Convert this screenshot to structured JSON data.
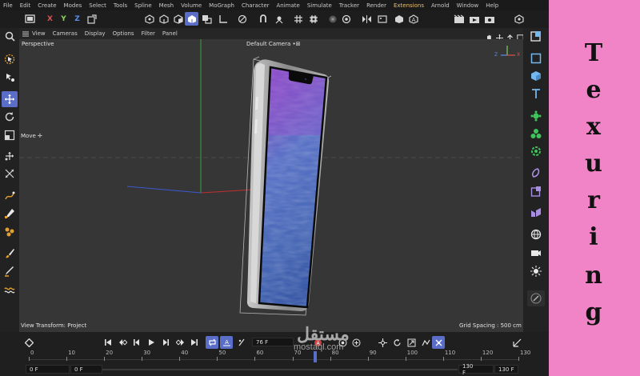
{
  "menubar": {
    "items": [
      {
        "label": "File",
        "hl": false
      },
      {
        "label": "Edit",
        "hl": false
      },
      {
        "label": "Create",
        "hl": false
      },
      {
        "label": "Modes",
        "hl": false
      },
      {
        "label": "Select",
        "hl": false
      },
      {
        "label": "Tools",
        "hl": false
      },
      {
        "label": "Spline",
        "hl": false
      },
      {
        "label": "Mesh",
        "hl": false
      },
      {
        "label": "Volume",
        "hl": false
      },
      {
        "label": "MoGraph",
        "hl": false
      },
      {
        "label": "Character",
        "hl": false
      },
      {
        "label": "Animate",
        "hl": false
      },
      {
        "label": "Simulate",
        "hl": false
      },
      {
        "label": "Tracker",
        "hl": false
      },
      {
        "label": "Render",
        "hl": false
      },
      {
        "label": "Extensions",
        "hl": true
      },
      {
        "label": "Arnold",
        "hl": false
      },
      {
        "label": "Window",
        "hl": false
      },
      {
        "label": "Help",
        "hl": false
      }
    ]
  },
  "toolbar": {
    "axis_x": "X",
    "axis_y": "Y",
    "axis_z": "Z"
  },
  "viewport_menu": {
    "items": [
      "View",
      "Cameras",
      "Display",
      "Options",
      "Filter",
      "Panel"
    ]
  },
  "viewport": {
    "projection_label": "Perspective",
    "camera_label": "Default Camera",
    "camera_suffix": "•⊞",
    "tool_label": "Move ✛",
    "view_transform": "View Transform: Project",
    "grid_spacing": "Grid Spacing : 500 cm",
    "axis_z": "Z",
    "axis_x": "X",
    "axis_y": "Y"
  },
  "timeline": {
    "current_frame": "76 F",
    "ticks": [
      "0",
      "10",
      "20",
      "30",
      "40",
      "50",
      "60",
      "70",
      "80",
      "90",
      "100",
      "110",
      "120",
      "130"
    ],
    "start_field": "0 F",
    "preview_start": "0 F",
    "preview_end": "130 F",
    "end_field": "130 F",
    "current_frame_value": 76,
    "max_frame": 130
  },
  "side_panel": {
    "letters": [
      "T",
      "e",
      "x",
      "u",
      "r",
      "i",
      "n",
      "g"
    ]
  },
  "watermark": {
    "arabic": "مستقل",
    "latin": "mostaql.com"
  },
  "colors": {
    "accent": "#5a6ec8",
    "side_panel": "#f084c6",
    "viewport_bg": "#363636",
    "axis_x": "#e05050",
    "axis_y": "#8fd060",
    "axis_z": "#5a8ee8"
  },
  "icons": {
    "left_toolbar": [
      "search-icon",
      "live-selection-icon",
      "sub-tool-icon",
      "move-icon",
      "rotate-icon",
      "scale-icon",
      "transform-icon",
      "extrude-icon",
      "spline-pen-icon",
      "sketch-icon",
      "paint-icon",
      "brush-icon",
      "knife-icon",
      "weight-icon"
    ],
    "right_toolbar": [
      "attribute-icon",
      "cube-outline-icon",
      "cube-icon",
      "text-icon",
      "generator-icon",
      "cloner-icon",
      "deformer-icon",
      "field-icon",
      "scene-icon",
      "cloth-icon",
      "environment-icon",
      "camera-icon",
      "light-icon",
      "edit-render-icon"
    ]
  }
}
